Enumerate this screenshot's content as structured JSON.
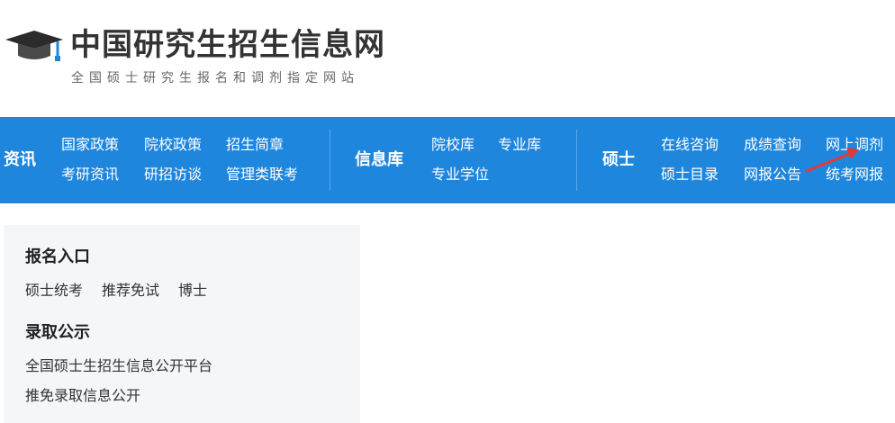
{
  "header": {
    "title": "中国研究生招生信息网",
    "subtitle": "全国硕士研究生报名和调剂指定网站",
    "logo_icon": "graduation-cap-icon"
  },
  "nav": {
    "group1": {
      "title": "资讯",
      "links": [
        "国家政策",
        "院校政策",
        "招生简章",
        "考研资讯",
        "研招访谈",
        "管理类联考"
      ]
    },
    "group2": {
      "title": "信息库",
      "links": [
        "院校库",
        "专业库",
        "专业学位"
      ]
    },
    "group3": {
      "title": "硕士",
      "links": [
        "在线咨询",
        "成绩查询",
        "网上调剂",
        "硕士目录",
        "网报公告",
        "统考网报"
      ]
    },
    "colors": {
      "bar": "#1e86dd",
      "annotation_arrow": "#e53935"
    }
  },
  "panel": {
    "section1": {
      "heading": "报名入口",
      "links": [
        "硕士统考",
        "推荐免试",
        "博士"
      ]
    },
    "section2": {
      "heading": "录取公示",
      "links": [
        "全国硕士生招生信息公开平台",
        "推免录取信息公开"
      ]
    }
  }
}
